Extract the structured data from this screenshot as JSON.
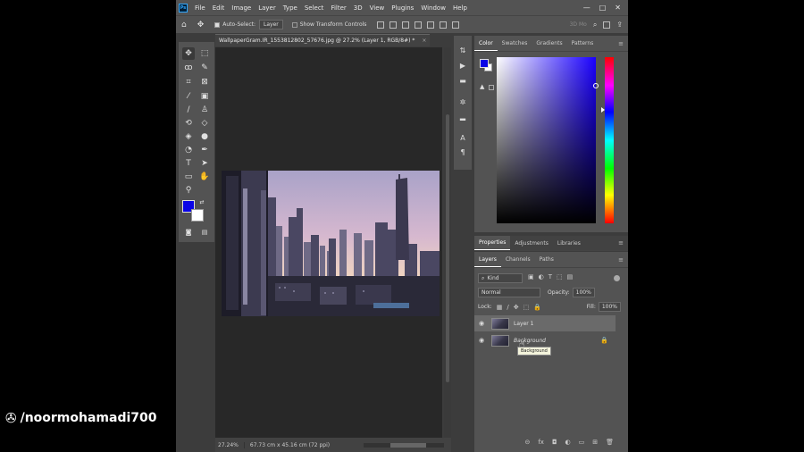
{
  "app": {
    "logo": "Ps",
    "menu": [
      "File",
      "Edit",
      "Image",
      "Layer",
      "Type",
      "Select",
      "Filter",
      "3D",
      "View",
      "Plugins",
      "Window",
      "Help"
    ],
    "window_controls": [
      "—",
      "□",
      "✕"
    ]
  },
  "options_bar": {
    "home": "⌂",
    "move_tool": "✥",
    "auto_select_label": "Auto-Select:",
    "auto_select_target": "Layer",
    "show_transform_label": "Show Transform Controls",
    "mode_3d": "3D Mo",
    "search": "⌕",
    "share": "⇪"
  },
  "toolbar": {
    "icons": [
      "move-icon",
      "marquee-icon",
      "lasso-icon",
      "quick-select-icon",
      "crop-icon",
      "frame-icon",
      "eyedropper-icon",
      "spot-heal-icon",
      "brush-icon",
      "clone-stamp-icon",
      "history-brush-icon",
      "eraser-icon",
      "paint-bucket-icon",
      "blur-icon",
      "dodge-icon",
      "pen-icon",
      "type-icon",
      "path-select-icon",
      "rectangle-icon",
      "hand-icon",
      "zoom-icon"
    ],
    "foreground_color": "#0a04e6",
    "background_color": "#ffffff"
  },
  "document": {
    "tab_title": "WallpaperGram.IR_1553812802_57676.jpg @ 27.2% (Layer 1, RGB/8#) *",
    "tab_close": "×",
    "zoom": "27.24%",
    "size": "67.73 cm x 45.16 cm (72 ppi)"
  },
  "color_panel": {
    "tabs": [
      "Color",
      "Swatches",
      "Gradients",
      "Patterns"
    ],
    "active_tab": "Color",
    "hue_color": "#1a00ff",
    "warning": "▲"
  },
  "props_panel": {
    "tabs": [
      "Properties",
      "Adjustments",
      "Libraries"
    ]
  },
  "layers_panel": {
    "tabs": [
      "Layers",
      "Channels",
      "Paths"
    ],
    "filter_kind": "Kind",
    "blend_mode": "Normal",
    "opacity_label": "Opacity:",
    "opacity_value": "100%",
    "lock_label": "Lock:",
    "fill_label": "Fill:",
    "fill_value": "100%",
    "layers": [
      {
        "name": "Layer 1",
        "selected": true
      },
      {
        "name": "Background",
        "selected": false,
        "locked": true
      }
    ],
    "tooltip": "Background",
    "bottom_icons": [
      "⊝",
      "fx",
      "◘",
      "◐",
      "▭",
      "⊞",
      "🗑"
    ]
  },
  "watermark": {
    "text": "/noormohamadi700"
  }
}
